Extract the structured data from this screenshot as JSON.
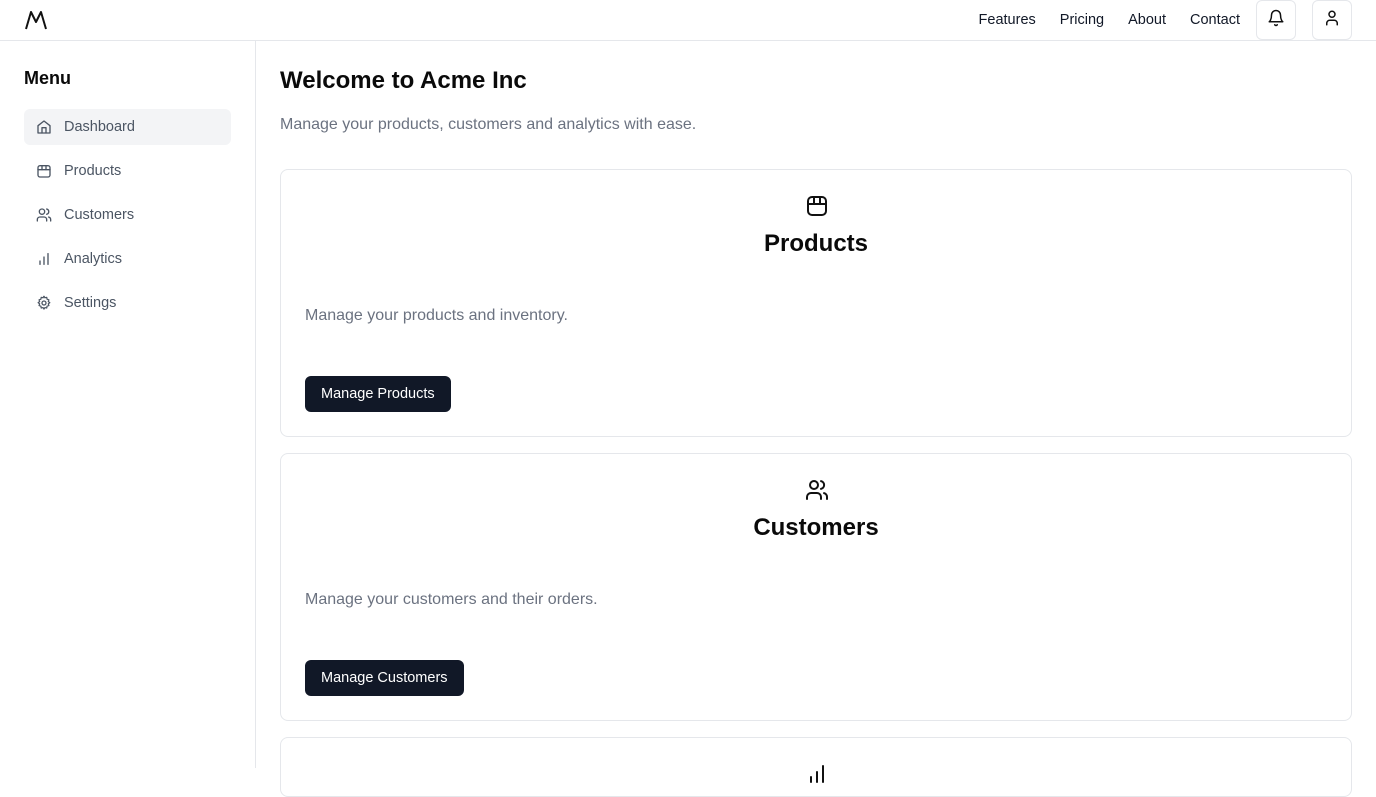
{
  "header": {
    "logo_icon": "mountain-logo-icon",
    "nav": [
      {
        "label": "Features"
      },
      {
        "label": "Pricing"
      },
      {
        "label": "About"
      },
      {
        "label": "Contact"
      }
    ],
    "notifications_icon": "bell-icon",
    "account_icon": "user-icon"
  },
  "sidebar": {
    "title": "Menu",
    "items": [
      {
        "label": "Dashboard",
        "icon": "home-icon",
        "active": true
      },
      {
        "label": "Products",
        "icon": "package-icon"
      },
      {
        "label": "Customers",
        "icon": "users-icon"
      },
      {
        "label": "Analytics",
        "icon": "bar-chart-icon"
      },
      {
        "label": "Settings",
        "icon": "gear-icon"
      }
    ]
  },
  "main": {
    "title": "Welcome to Acme Inc",
    "subtitle": "Manage your products, customers and analytics with ease.",
    "cards": [
      {
        "icon": "package-icon",
        "title": "Products",
        "description": "Manage your products and inventory.",
        "button": "Manage Products"
      },
      {
        "icon": "users-icon",
        "title": "Customers",
        "description": "Manage your customers and their orders.",
        "button": "Manage Customers"
      }
    ]
  },
  "colors": {
    "primary_button": "#111827",
    "muted_text": "#6b7280",
    "border": "#e5e7eb",
    "active_bg": "#f3f4f6"
  }
}
